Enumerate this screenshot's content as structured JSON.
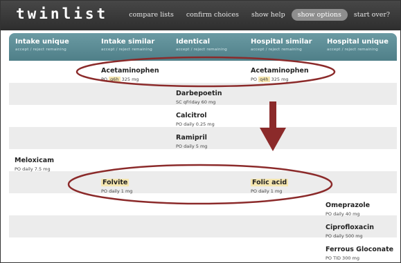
{
  "app": {
    "title": "twinlist"
  },
  "nav": [
    {
      "label": "compare lists",
      "active": false
    },
    {
      "label": "confirm choices",
      "active": false
    },
    {
      "label": "show help",
      "active": false
    },
    {
      "label": "show options",
      "active": true
    },
    {
      "label": "start over?",
      "active": false
    }
  ],
  "columns": [
    {
      "title": "Intake unique",
      "sub": "accept  /  reject remaining"
    },
    {
      "title": "Intake similar",
      "sub": "accept  /  reject remaining"
    },
    {
      "title": "Identical",
      "sub": "accept  /  reject remaining"
    },
    {
      "title": "Hospital similar",
      "sub": "accept  /  reject remaining"
    },
    {
      "title": "Hospital unique",
      "sub": "accept  /  reject remaining"
    }
  ],
  "meds": {
    "intake_similar_1": {
      "name": "Acetaminophen",
      "route": "PO",
      "freq": "q6h",
      "dose": "325 mg"
    },
    "hospital_similar_1": {
      "name": "Acetaminophen",
      "route": "PO",
      "freq": "q4h",
      "dose": "325 mg"
    },
    "identical_1": {
      "name": "Darbepoetin",
      "line": "SC  qFriday  60 mg"
    },
    "identical_2": {
      "name": "Calcitrol",
      "line": "PO  daily  0.25 mg"
    },
    "identical_3": {
      "name": "Ramipril",
      "line": "PO  daily  5 mg"
    },
    "intake_unique_1": {
      "name": "Meloxicam",
      "line": "PO  daily  7.5 mg"
    },
    "intake_similar_2": {
      "name": "Folvite",
      "line": "PO  daily  1 mg"
    },
    "hospital_similar_2": {
      "name": "Folic acid",
      "line": "PO  daily  1 mg"
    },
    "hospital_unique_1": {
      "name": "Omeprazole",
      "line": "PO  daily  40 mg"
    },
    "hospital_unique_2": {
      "name": "Ciprofloxacin",
      "line": "PO  daily  500 mg"
    },
    "hospital_unique_3": {
      "name": "Ferrous Gloconate",
      "line": "PO  TID  300 mg"
    }
  },
  "colors": {
    "header": "#5f8f98",
    "highlight": "#f5e6b0",
    "annotation": "#8b2a2a",
    "alt_row": "#ececec"
  },
  "icons": {
    "annotation_arrow": "down-arrow-icon"
  }
}
